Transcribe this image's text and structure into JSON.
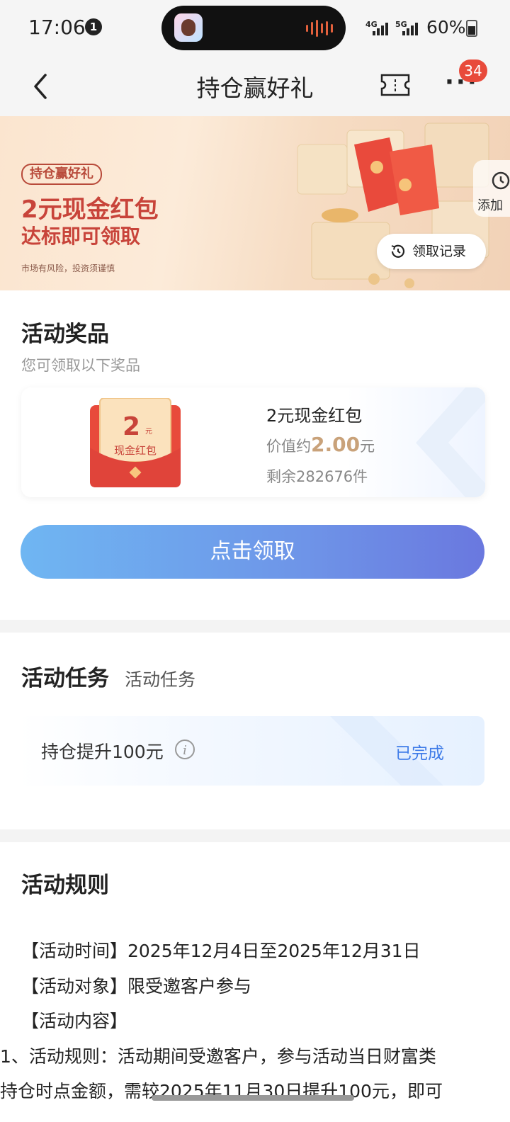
{
  "status_bar": {
    "time": "17:06",
    "notification_count": "1",
    "net1": "4G",
    "net2": "5G",
    "battery": "60%"
  },
  "navbar": {
    "title": "持仓赢好礼",
    "badge": "34"
  },
  "banner": {
    "tag": "持仓赢好礼",
    "headline": "2元现金红包",
    "subline": "达标即可领取",
    "risk": "市场有风险，投资须谨慎",
    "record_button": "领取记录",
    "side_float": "添加"
  },
  "prizes": {
    "title": "活动奖品",
    "subtitle": "您可领取以下奖品",
    "envelope_amount": "2",
    "envelope_unit": "元",
    "envelope_label": "现金红包",
    "name": "2元现金红包",
    "value_prefix": "价值约",
    "value": "2.00",
    "value_unit": "元",
    "remaining": "剩余282676件",
    "claim_button": "点击领取"
  },
  "tasks": {
    "title": "活动任务",
    "subtitle": "活动任务",
    "items": [
      {
        "name": "持仓提升100元",
        "status": "已完成"
      }
    ]
  },
  "rules": {
    "title": "活动规则",
    "lines": [
      "【活动时间】2025年12月4日至2025年12月31日",
      "【活动对象】限受邀客户参与",
      "【活动内容】",
      "1、活动规则：活动期间受邀客户，参与活动当日财富类",
      "持仓时点金额，需较2025年11月30日提升100元，即可"
    ]
  },
  "colors": {
    "accent_red": "#c8443a",
    "button_gradient_start": "#6fb6f2",
    "button_gradient_end": "#6a78df",
    "status_blue": "#3e7be8",
    "badge_red": "#e84a3b"
  }
}
